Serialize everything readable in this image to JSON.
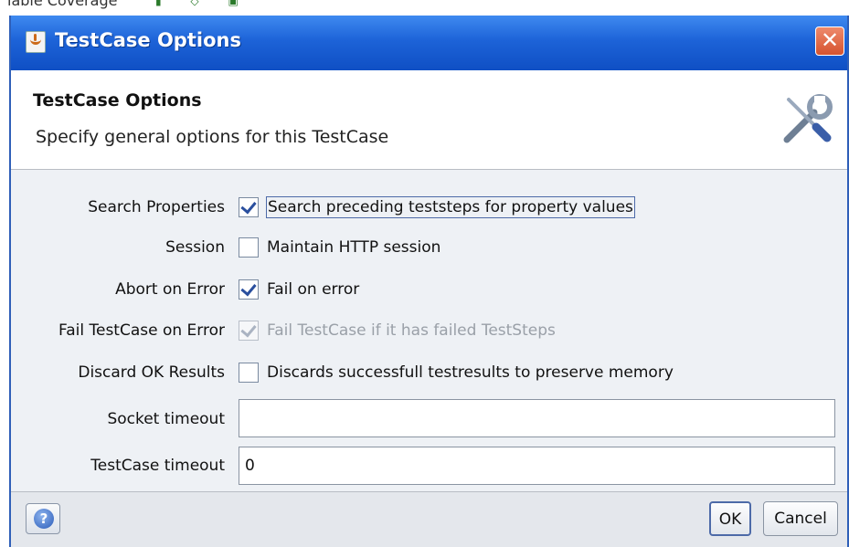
{
  "background_strip": {
    "text": "iable Coverage"
  },
  "window": {
    "title": "TestCase Options",
    "close_glyph": "✕"
  },
  "header": {
    "title": "TestCase Options",
    "description": "Specify general options for this TestCase"
  },
  "options": [
    {
      "label": "Search Properties",
      "text": "Search preceding teststeps for property values",
      "checked": true,
      "enabled": true,
      "focused": true
    },
    {
      "label": "Session",
      "text": "Maintain HTTP session",
      "checked": false,
      "enabled": true,
      "focused": false
    },
    {
      "label": "Abort on Error",
      "text": "Fail on error",
      "checked": true,
      "enabled": true,
      "focused": false
    },
    {
      "label": "Fail TestCase on Error",
      "text": "Fail TestCase if it has failed TestSteps",
      "checked": true,
      "enabled": false,
      "focused": false
    },
    {
      "label": "Discard OK Results",
      "text": "Discards successfull testresults to preserve memory",
      "checked": false,
      "enabled": true,
      "focused": false
    }
  ],
  "fields": {
    "socket_timeout": {
      "label": "Socket timeout",
      "value": ""
    },
    "testcase_timeout": {
      "label": "TestCase timeout",
      "value": "0"
    }
  },
  "footer": {
    "help_glyph": "?",
    "ok_label": "OK",
    "cancel_label": "Cancel"
  },
  "colors": {
    "titlebar": "#1d63d8",
    "close_button": "#d6532f",
    "checkbox_tick": "#2a4f9e",
    "disabled_text": "#9aa0a8"
  },
  "icons": {
    "title": "java-cup-icon",
    "close": "close-icon",
    "header": "wrench-screwdriver-icon",
    "help": "help-icon"
  }
}
